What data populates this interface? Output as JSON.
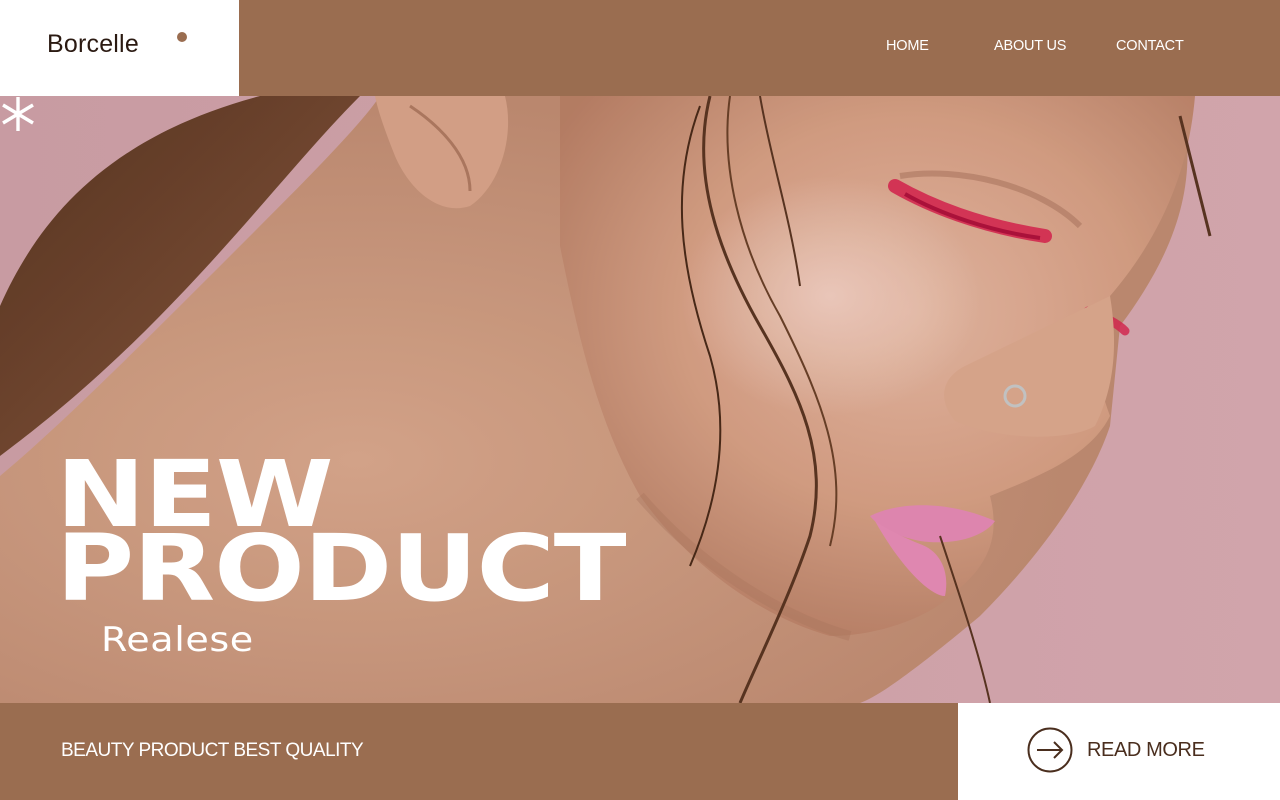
{
  "brand": {
    "name": "Borcelle",
    "accent_color": "#9a6d50",
    "dark_color": "#4a2e1e"
  },
  "nav": {
    "items": [
      {
        "label": "HOME"
      },
      {
        "label": "ABOUT US"
      },
      {
        "label": "CONTACT"
      }
    ]
  },
  "hero": {
    "headline_line1": "NEW",
    "headline_line2": "PRODUCT",
    "subline": "Realese",
    "star_icon": "asterisk-icon"
  },
  "footer": {
    "tagline": "BEAUTY PRODUCT BEST QUALITY",
    "cta_label": "READ MORE",
    "cta_icon": "arrow-right-icon"
  }
}
